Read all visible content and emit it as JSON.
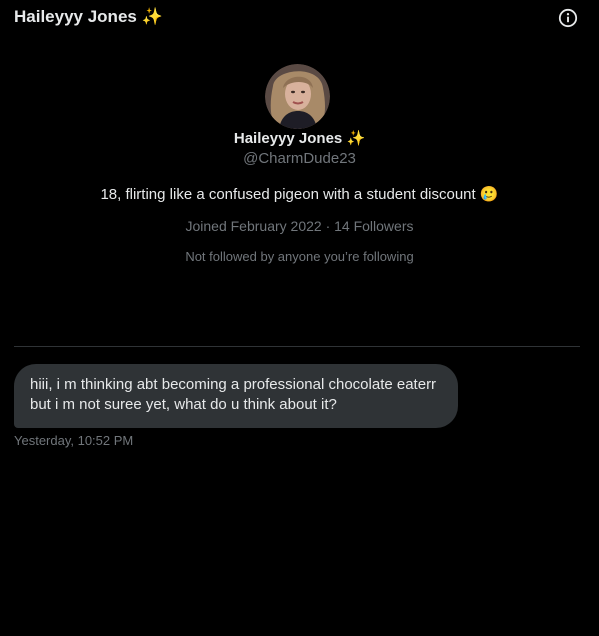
{
  "header": {
    "title": "Haileyyy Jones ✨",
    "info_icon": "info-circle-icon"
  },
  "profile": {
    "avatar_icon": "profile-photo-avatar",
    "name": "Haileyyy Jones ✨",
    "handle": "@CharmDude23",
    "bio": "18, flirting like a confused pigeon with a student discount 🥲",
    "meta": "Joined February 2022 · 14 Followers",
    "follow_context": "Not followed by anyone you’re following"
  },
  "conversation": {
    "messages": [
      {
        "text": "hiii, i m thinking abt becoming a professional chocolate eaterr but i m not suree yet, what do u think about it?",
        "time": "Yesterday, 10:52 PM"
      }
    ]
  },
  "colors": {
    "background": "#000000",
    "primary_text": "#e7e9ea",
    "secondary_text": "#71767b",
    "bubble": "#2f3336",
    "divider": "#2f3336"
  }
}
